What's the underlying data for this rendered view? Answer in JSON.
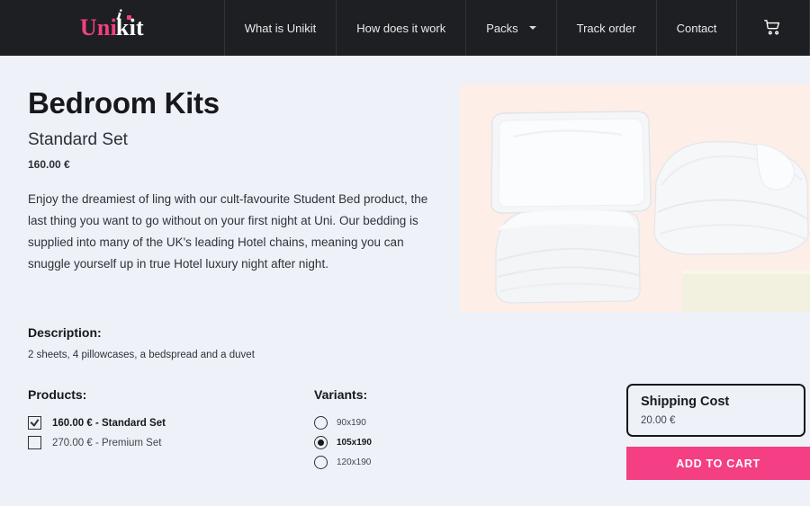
{
  "navbar": {
    "logo": {
      "first": "Uni",
      "second": "kit",
      "mark": "i"
    },
    "items": [
      {
        "label": "What is Unikit",
        "has_caret": false
      },
      {
        "label": "How does it work",
        "has_caret": false
      },
      {
        "label": "Packs",
        "has_caret": true
      },
      {
        "label": "Track order",
        "has_caret": false
      },
      {
        "label": "Contact",
        "has_caret": false
      }
    ],
    "cart_icon": "shopping-cart-icon"
  },
  "product": {
    "title": "Bedroom Kits",
    "subtitle": "Standard Set",
    "price": "160.00 €",
    "description": "Enjoy the dreamiest of ling with our cult-favourite Student Bed product, the last thing you want to go without on your first night at Uni. Our bedding is supplied into many of the UK's leading Hotel chains, meaning you can snuggle yourself up in true Hotel luxury night after night."
  },
  "description_section": {
    "heading": "Description:",
    "contents": "2 sheets, 4 pillowcases, a bedspread and a duvet"
  },
  "products_section": {
    "heading": "Products:",
    "options": [
      {
        "label": "160.00 € - Standard Set",
        "checked": true
      },
      {
        "label": "270.00 € - Premium Set",
        "checked": false
      }
    ]
  },
  "variants_section": {
    "heading": "Variants:",
    "options": [
      {
        "label": "90x190",
        "selected": false
      },
      {
        "label": "105x190",
        "selected": true
      },
      {
        "label": "120x190",
        "selected": false
      }
    ]
  },
  "shipping": {
    "title": "Shipping Cost",
    "cost": "20.00 €"
  },
  "cart_button": {
    "label": "ADD TO CART"
  },
  "colors": {
    "accent_pink": "#f43f84",
    "navbar_bg": "#1e1f22",
    "page_bg": "#eef1f7",
    "image_bg": "#fdeee8"
  }
}
